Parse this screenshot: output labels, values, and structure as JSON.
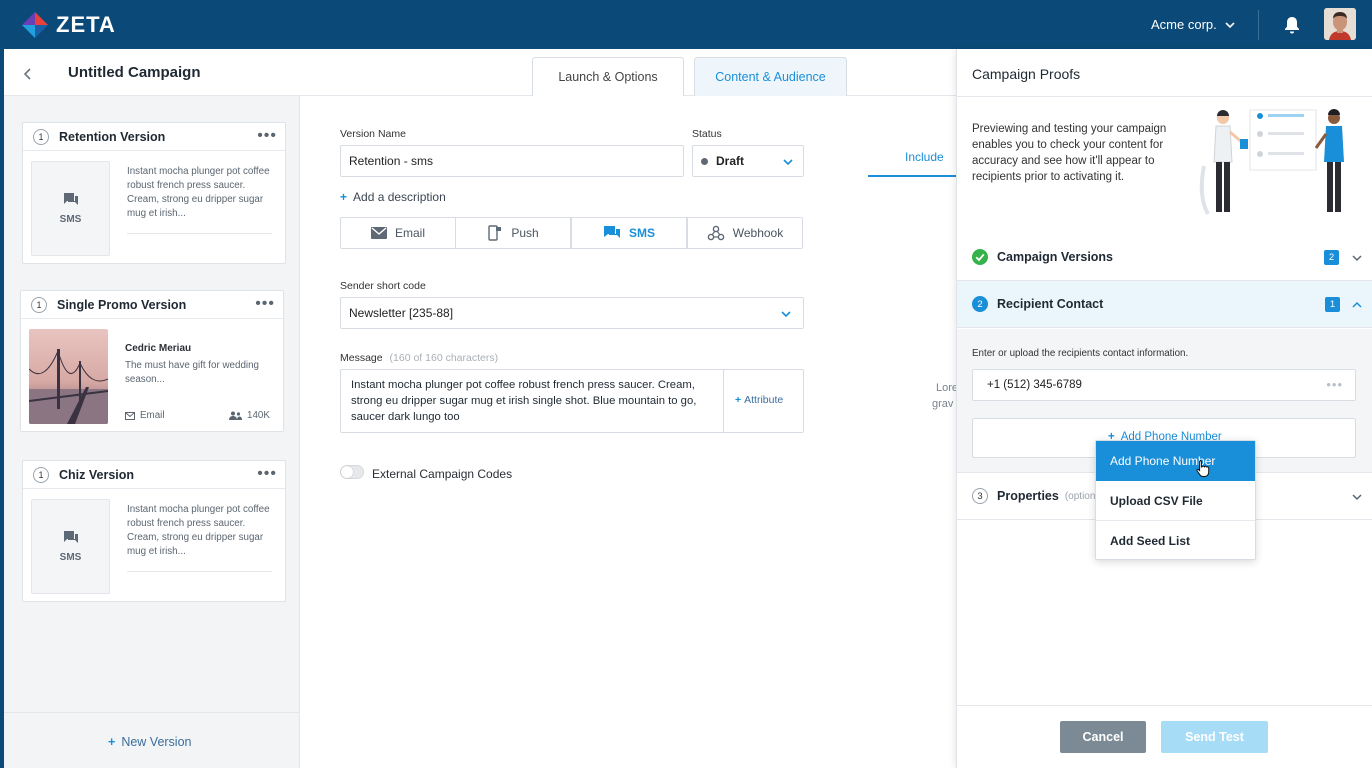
{
  "topbar": {
    "logo_text": "ZETA",
    "org_name": "Acme corp."
  },
  "header": {
    "back_icon": "chevron-left-icon",
    "title": "Untitled Campaign",
    "tabs": [
      {
        "label": "Launch & Options",
        "active": false
      },
      {
        "label": "Content & Audience",
        "active": true
      }
    ]
  },
  "versions": {
    "items": [
      {
        "number": "1",
        "name": "Retention Version",
        "thumb_label": "SMS",
        "text": "Instant mocha plunger pot coffee robust french press saucer. Cream, strong eu dripper sugar mug et irish..."
      },
      {
        "number": "1",
        "name": "Single Promo Version",
        "sender": "Cedric Meriau",
        "text": "The must have gift for wedding season...",
        "channel": "Email",
        "audience": "140K"
      },
      {
        "number": "1",
        "name": "Chiz Version",
        "thumb_label": "SMS",
        "text": "Instant mocha plunger pot coffee robust french press saucer. Cream, strong eu dripper sugar mug et irish..."
      }
    ],
    "new_version_label": "New Version"
  },
  "form": {
    "version_name_label": "Version Name",
    "version_name_value": "Retention - sms",
    "status_label": "Status",
    "status_value": "Draft",
    "add_description": "Add a description",
    "channels": [
      {
        "label": "Email",
        "active": false
      },
      {
        "label": "Push",
        "active": false
      },
      {
        "label": "SMS",
        "active": true
      },
      {
        "label": "Webhook",
        "active": false
      }
    ],
    "sender_label": "Sender short code",
    "sender_value": "Newsletter [235-88]",
    "message_label": "Message",
    "message_count": "(160 of 160 characters)",
    "message_text": "Instant mocha plunger pot coffee robust french press saucer. Cream, strong eu dripper sugar mug et irish single shot. Blue mountain to go, saucer dark lungo too",
    "attribute_label": "Attribute",
    "external_codes_label": "External Campaign Codes",
    "include_tab": "Include",
    "partial_text_1": "Lore",
    "partial_text_2": "grav"
  },
  "proofs": {
    "title": "Campaign Proofs",
    "intro": "Previewing and testing your campaign enables you to check your content for accuracy and see how it'll appear to recipients prior to activating it.",
    "sections": [
      {
        "step": "1",
        "label": "Campaign Versions",
        "badge": "2",
        "done": true
      },
      {
        "step": "2",
        "label": "Recipient Contact",
        "badge": "1",
        "expanded": true
      },
      {
        "step": "3",
        "label": "Properties",
        "optional": "(optional)"
      }
    ],
    "recipient_hint": "Enter or upload the recipients contact information.",
    "phone_value": "+1 (512) 345-6789",
    "add_phone_button": "Add Phone Number",
    "menu": [
      {
        "label": "Add Phone Number",
        "highlighted": true
      },
      {
        "label": "Upload CSV File"
      },
      {
        "label": "Add Seed List"
      }
    ],
    "cancel": "Cancel",
    "send_test": "Send Test"
  },
  "colors": {
    "topbar": "#0b4a78",
    "accent": "#1a8fd9",
    "success": "#35b34a"
  }
}
